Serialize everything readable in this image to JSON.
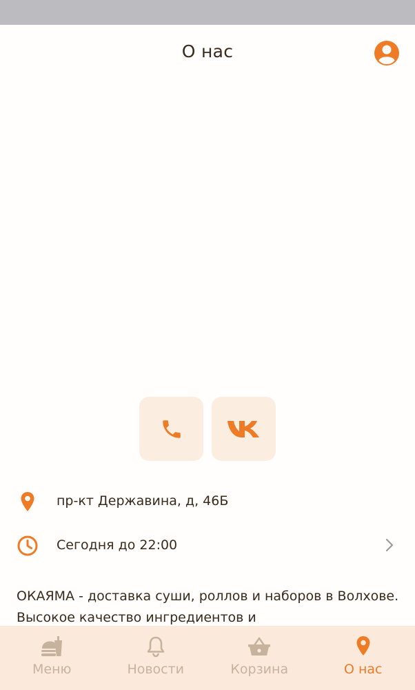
{
  "header": {
    "title": "О нас",
    "profile_icon": "user-circle-icon"
  },
  "contacts": {
    "phone_icon": "phone-icon",
    "vk_icon": "vk-icon"
  },
  "info": {
    "address": "пр-кт Державина, д, 46Б",
    "hours": "Сегодня до 22:00"
  },
  "description": "ОКАЯМА - доставка суши, роллов и наборов в Волхове. Высокое качество ингредиентов и",
  "tabs": [
    {
      "label": "Меню",
      "icon": "menu-food-icon",
      "active": false
    },
    {
      "label": "Новости",
      "icon": "bell-icon",
      "active": false
    },
    {
      "label": "Корзина",
      "icon": "basket-icon",
      "active": false
    },
    {
      "label": "О нас",
      "icon": "location-pin-icon",
      "active": true
    }
  ],
  "colors": {
    "accent": "#ee7c27",
    "button_bg": "#fbeee0",
    "tab_bar_bg": "#fbeadb",
    "tab_inactive": "#c7b29e",
    "text": "#3a2a1c"
  }
}
